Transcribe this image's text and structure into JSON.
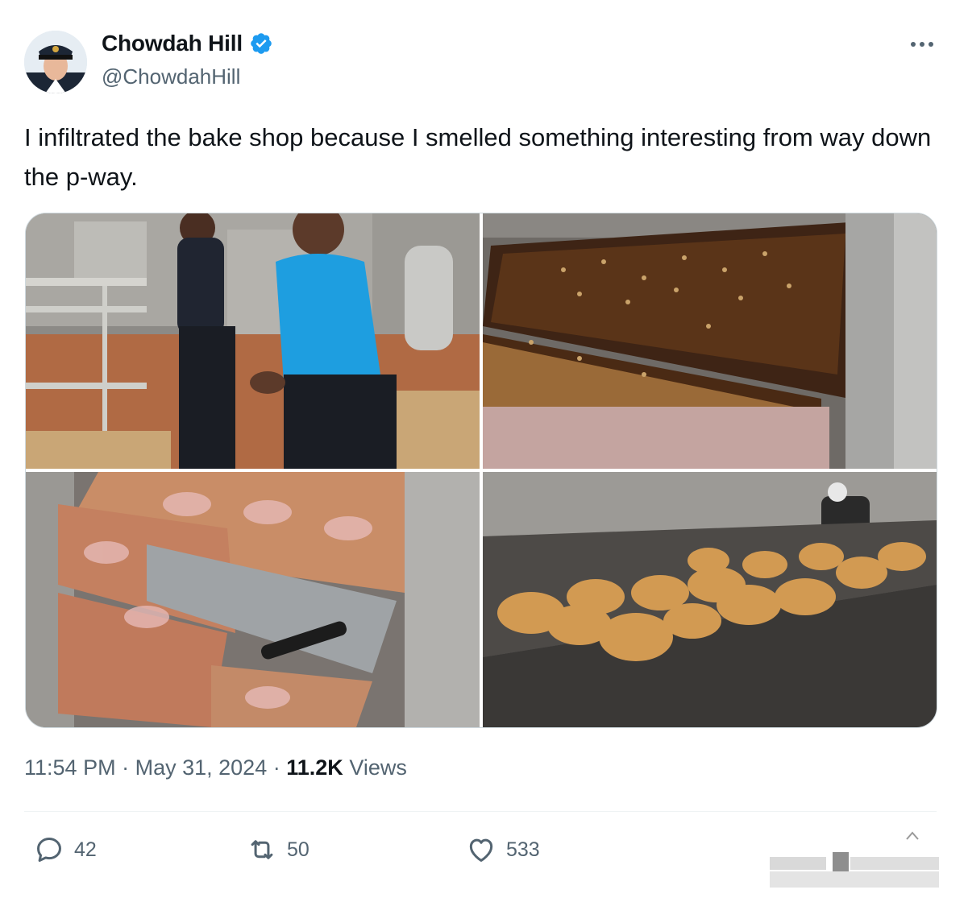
{
  "user": {
    "display_name": "Chowdah Hill",
    "handle": "@ChowdahHill",
    "verified": true,
    "verified_color": "#1d9bf0"
  },
  "tweet": {
    "text": "I infiltrated the bake shop because I smelled something interesting from way down the p-way."
  },
  "media": [
    {
      "description_icon": "photo",
      "subject": "two bakers in a kitchen"
    },
    {
      "description_icon": "photo",
      "subject": "sheet trays of nut-topped bars"
    },
    {
      "description_icon": "photo",
      "subject": "rack of iced cinnamon rolls"
    },
    {
      "description_icon": "photo",
      "subject": "muffin tins of baked muffins"
    }
  ],
  "meta": {
    "time": "11:54 PM",
    "separator": "·",
    "date": "May 31, 2024",
    "views_count": "11.2K",
    "views_label": "Views"
  },
  "actions": {
    "reply_count": "42",
    "retweet_count": "50",
    "like_count": "533",
    "reply_icon": "reply-icon",
    "retweet_icon": "retweet-icon",
    "like_icon": "heart-icon"
  },
  "colors": {
    "text_primary": "#0f1419",
    "text_secondary": "#536471",
    "border": "#cfd9de"
  }
}
